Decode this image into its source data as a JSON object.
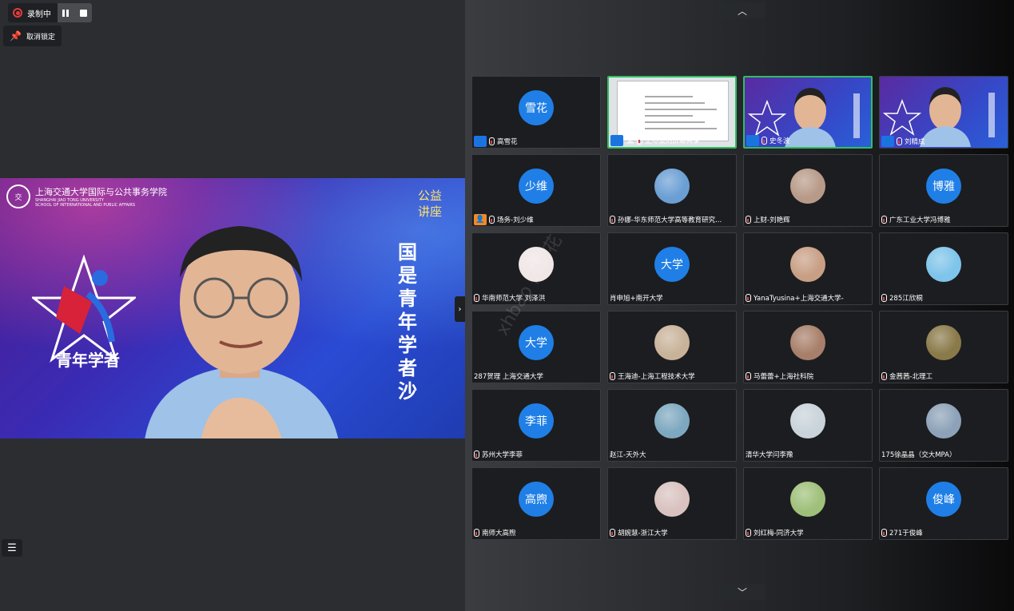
{
  "recording": {
    "status": "录制中",
    "unpin_label": "取消锁定"
  },
  "speaker": {
    "school_cn": "上海交通大学国际与公共事务学院",
    "school_en_1": "SHANGHAI JIAO TONG UNIVERSITY",
    "school_en_2": "SCHOOL OF INTERNATIONAL AND PUBLIC AFFAIRS",
    "lecture_tag_1": "公益",
    "lecture_tag_2": "讲座",
    "vertical_title": "国是青年学者沙",
    "logo_text": "青年学者"
  },
  "watermark": "xhbao 高雪花",
  "tiles": [
    {
      "label": "高雪花",
      "avatar_text": "雪花",
      "kind": "avatar",
      "badge": "blue",
      "mic": true
    },
    {
      "label": "史冬波的屏幕共享",
      "kind": "doc",
      "badge": "blue",
      "mic": true,
      "screen": true,
      "active": true
    },
    {
      "label": "史冬波",
      "kind": "slide",
      "badge": "blue",
      "mic": true,
      "active": true
    },
    {
      "label": "刘精成",
      "kind": "slide",
      "badge": "blue",
      "mic": true
    },
    {
      "label": "场务-刘少维",
      "avatar_text": "少维",
      "kind": "avatar",
      "badge": "orange",
      "mic": true
    },
    {
      "label": "孙娜-华东师范大学高等教育研究...",
      "kind": "photo",
      "color": "#6b9fd4",
      "mic": true
    },
    {
      "label": "上财-刘艳辉",
      "kind": "photo",
      "color": "#b89a88",
      "mic": true
    },
    {
      "label": "广东工业大学冯博雅",
      "avatar_text": "博雅",
      "kind": "avatar",
      "mic": true
    },
    {
      "label": "华南师范大学 刘泽洪",
      "kind": "photo",
      "color": "#f0e6e6",
      "mic": true
    },
    {
      "label": "肖申旭+南开大学",
      "avatar_text": "大学",
      "kind": "avatar",
      "mic": false
    },
    {
      "label": "YanaTyusina+上海交通大学-",
      "kind": "photo",
      "color": "#c89f85",
      "mic": true
    },
    {
      "label": "285江欣桐",
      "kind": "photo",
      "color": "#7fc4ea",
      "mic": true
    },
    {
      "label": "287贺理 上海交通大学",
      "avatar_text": "大学",
      "kind": "avatar",
      "mic": false
    },
    {
      "label": "王海迪-上海工程技术大学",
      "kind": "photo",
      "color": "#c8b39a",
      "mic": true
    },
    {
      "label": "马蕾蕾+上海社科院",
      "kind": "photo",
      "color": "#a87f6a",
      "mic": true
    },
    {
      "label": "金茜茜-北理工",
      "kind": "photo",
      "color": "#8a7a4a",
      "mic": true
    },
    {
      "label": "苏州大学李菲",
      "avatar_text": "李菲",
      "kind": "avatar",
      "mic": true
    },
    {
      "label": "赵江-天外大",
      "kind": "photo",
      "color": "#7da8c0",
      "mic": false
    },
    {
      "label": "清华大学闫李豫",
      "kind": "photo",
      "color": "#c9d3da",
      "mic": false
    },
    {
      "label": "175徐晶晶（交大MPA）",
      "kind": "photo",
      "color": "#8da2b8",
      "mic": false
    },
    {
      "label": "南师大高煦",
      "avatar_text": "高煦",
      "kind": "avatar",
      "mic": true
    },
    {
      "label": "胡婉慧-浙江大学",
      "kind": "photo",
      "color": "#d9c2bf",
      "mic": true
    },
    {
      "label": "刘红梅-同济大学",
      "kind": "photo",
      "color": "#9fc07a",
      "mic": true
    },
    {
      "label": "271于俊峰",
      "avatar_text": "俊峰",
      "kind": "avatar",
      "mic": true
    }
  ]
}
